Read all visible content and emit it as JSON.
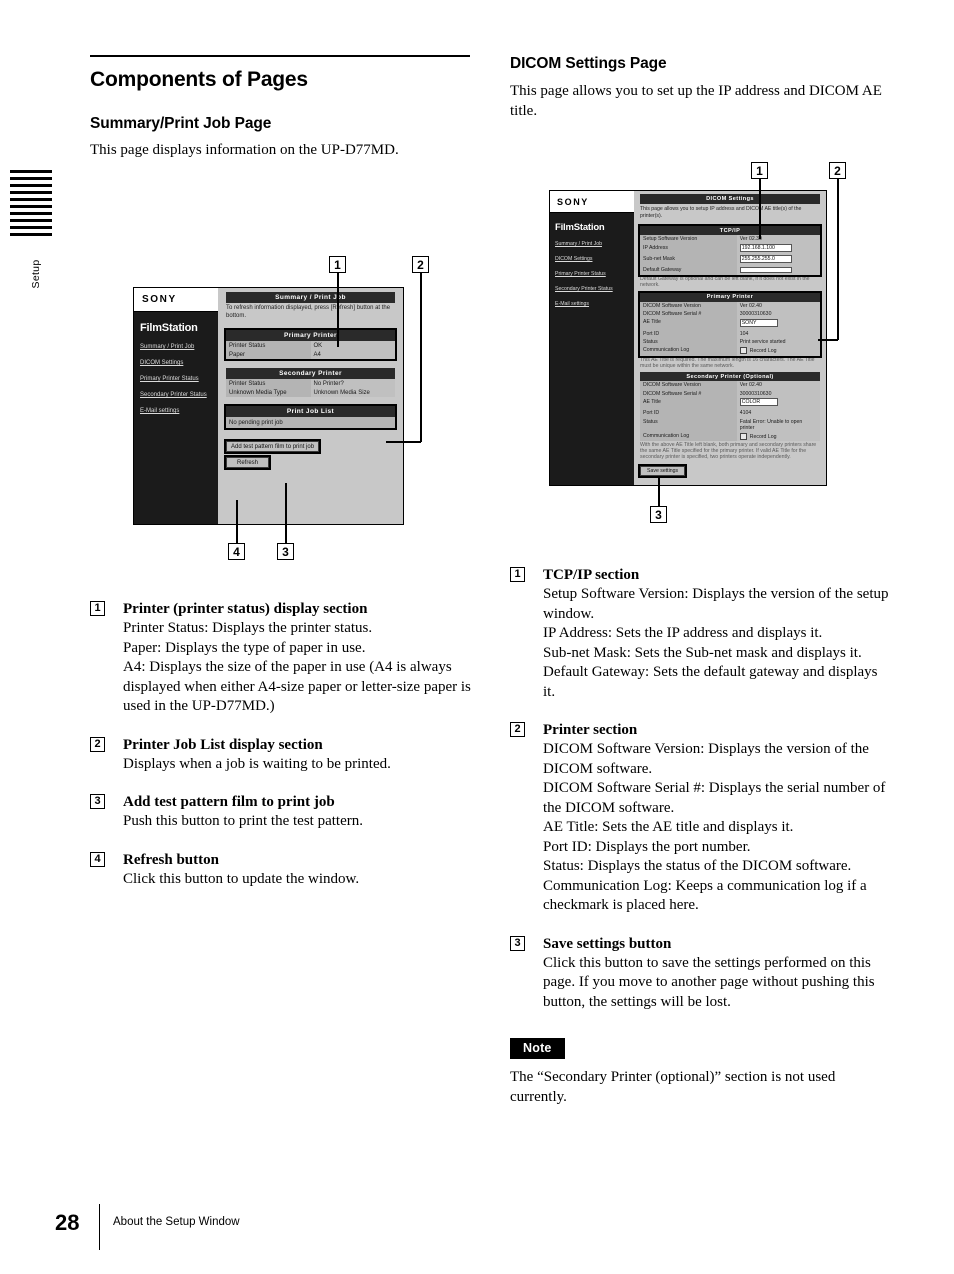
{
  "side_tab": {
    "label": "Setup"
  },
  "left_column": {
    "chapter_title": "Components of Pages",
    "section_title": "Summary/Print Job Page",
    "intro": "This page displays information on the UP-D77MD.",
    "items": [
      {
        "num": "1",
        "title": "Printer (printer status) display section",
        "text": "Printer Status: Displays the printer status.\nPaper: Displays the type of paper in use.\nA4: Displays the size of the paper in use (A4 is always displayed when either A4-size paper or letter-size paper is used in the UP-D77MD.)"
      },
      {
        "num": "2",
        "title": "Printer Job List display section",
        "text": "Displays when a job is waiting to be printed."
      },
      {
        "num": "3",
        "title": "Add test pattern film to print job",
        "text": "Push this button to print the test pattern."
      },
      {
        "num": "4",
        "title": "Refresh button",
        "text": "Click this button to update the window."
      }
    ]
  },
  "right_column": {
    "section_title": "DICOM Settings Page",
    "intro": "This page allows you to set up the IP address and DICOM AE title.",
    "items": [
      {
        "num": "1",
        "title": "TCP/IP section",
        "text": "Setup Software Version: Displays the version of the setup window.\nIP Address: Sets the IP address and displays it.\nSub-net Mask: Sets the Sub-net mask and displays it.\nDefault Gateway: Sets the default gateway and displays it."
      },
      {
        "num": "2",
        "title": "Printer section",
        "text": "DICOM Software Version: Displays the version of the DICOM software.\nDICOM Software Serial #: Displays the serial number of the DICOM software.\nAE Title: Sets the AE title and displays it.\nPort ID: Displays the port number.\nStatus: Displays the status of the DICOM software.\nCommunication Log: Keeps a communication log if a checkmark is placed here."
      },
      {
        "num": "3",
        "title": "Save settings button",
        "text": "Click this button to save the settings performed on this page. If you move to another page without pushing this button, the settings will be lost."
      }
    ],
    "note": {
      "badge": "Note",
      "text": "The “Secondary Printer (optional)” section is not used currently."
    }
  },
  "figure_summary": {
    "callouts": [
      "1",
      "2",
      "3",
      "4"
    ],
    "sony_logo": "SONY",
    "brand": "FilmStation",
    "nav_links": [
      "Summary / Print Job",
      "DICOM Settings",
      "Primary Printer Status",
      "Secondary Printer Status",
      "E-Mail settings"
    ],
    "page_header": "Summary / Print Job",
    "page_hint": "To refresh information displayed, press [Refresh] button at the bottom.",
    "primary_printer": {
      "header": "Primary Printer",
      "rows": [
        {
          "label": "Printer Status",
          "value": "OK"
        },
        {
          "label": "Paper",
          "value": "A4"
        }
      ]
    },
    "secondary_printer": {
      "header": "Secondary Printer",
      "rows": [
        {
          "label": "Printer Status",
          "value": "No Printer?"
        },
        {
          "label": "Unknown Media Type",
          "value": "Unknown Media Size"
        }
      ]
    },
    "print_job_list": {
      "header": "Print Job List",
      "rows": [
        {
          "label": "No pending print job",
          "value": ""
        }
      ]
    },
    "buttons": {
      "add_test_pattern": "Add test pattern film to print job",
      "refresh": "Refresh"
    }
  },
  "figure_dicom": {
    "callouts": [
      "1",
      "2",
      "3"
    ],
    "sony_logo": "SONY",
    "brand": "FilmStation",
    "nav_links": [
      "Summary / Print Job",
      "DICOM Settings",
      "Primary Printer Status",
      "Secondary Printer Status",
      "E-Mail settings"
    ],
    "page_header": "DICOM Settings",
    "page_hint": "This page allows you to setup IP address and DICOM AE title(s) of the printer(s).",
    "tcpip": {
      "header": "TCP/IP",
      "rows": [
        {
          "label": "Setup Software Version",
          "value": "Ver 02.30",
          "input": false
        },
        {
          "label": "IP Address",
          "value": "192.168.1.100",
          "input": true
        },
        {
          "label": "Sub-net Mask",
          "value": "255.255.255.0",
          "input": true
        },
        {
          "label": "Default Gateway",
          "value": "",
          "input": true
        }
      ],
      "hint": "Default Gateway is optional and can be left blank, if it does not exist in the network."
    },
    "primary_printer": {
      "header": "Primary Printer",
      "rows": [
        {
          "label": "DICOM Software Version",
          "value": "Ver 02.40",
          "input": false
        },
        {
          "label": "DICOM Software Serial #",
          "value": "30000310630",
          "input": false
        },
        {
          "label": "AE Title",
          "value": "SONY",
          "input": true
        },
        {
          "label": "Port ID",
          "value": "104",
          "input": false
        },
        {
          "label": "Status",
          "value": "Print service started",
          "input": false
        },
        {
          "label": "Communication Log",
          "value": "Record Log",
          "input": false,
          "checkbox": true
        }
      ],
      "hint": "This AE Title is required. The maximum length is 16 characters. The AE Title must be unique within the same network."
    },
    "secondary_printer": {
      "header": "Secondary Printer (Optional)",
      "rows": [
        {
          "label": "DICOM Software Version",
          "value": "Ver 02.40",
          "input": false
        },
        {
          "label": "DICOM Software Serial #",
          "value": "30000310630",
          "input": false
        },
        {
          "label": "AE Title",
          "value": "COLOR",
          "input": true
        },
        {
          "label": "Port ID",
          "value": "4104",
          "input": false
        },
        {
          "label": "Status",
          "value": "Fatal Error: Unable to open printer",
          "input": false
        },
        {
          "label": "Communication Log",
          "value": "Record Log",
          "input": false,
          "checkbox": true
        }
      ],
      "hint": "With the above AE Title left blank, both primary and secondary printers share the same AE Title specified for the primary printer. If valid AE Title for the secondary printer is specified, two printers operate independently."
    },
    "buttons": {
      "save_settings": "Save settings"
    }
  },
  "footer": {
    "page_number": "28",
    "running_head": "About the Setup Window"
  }
}
